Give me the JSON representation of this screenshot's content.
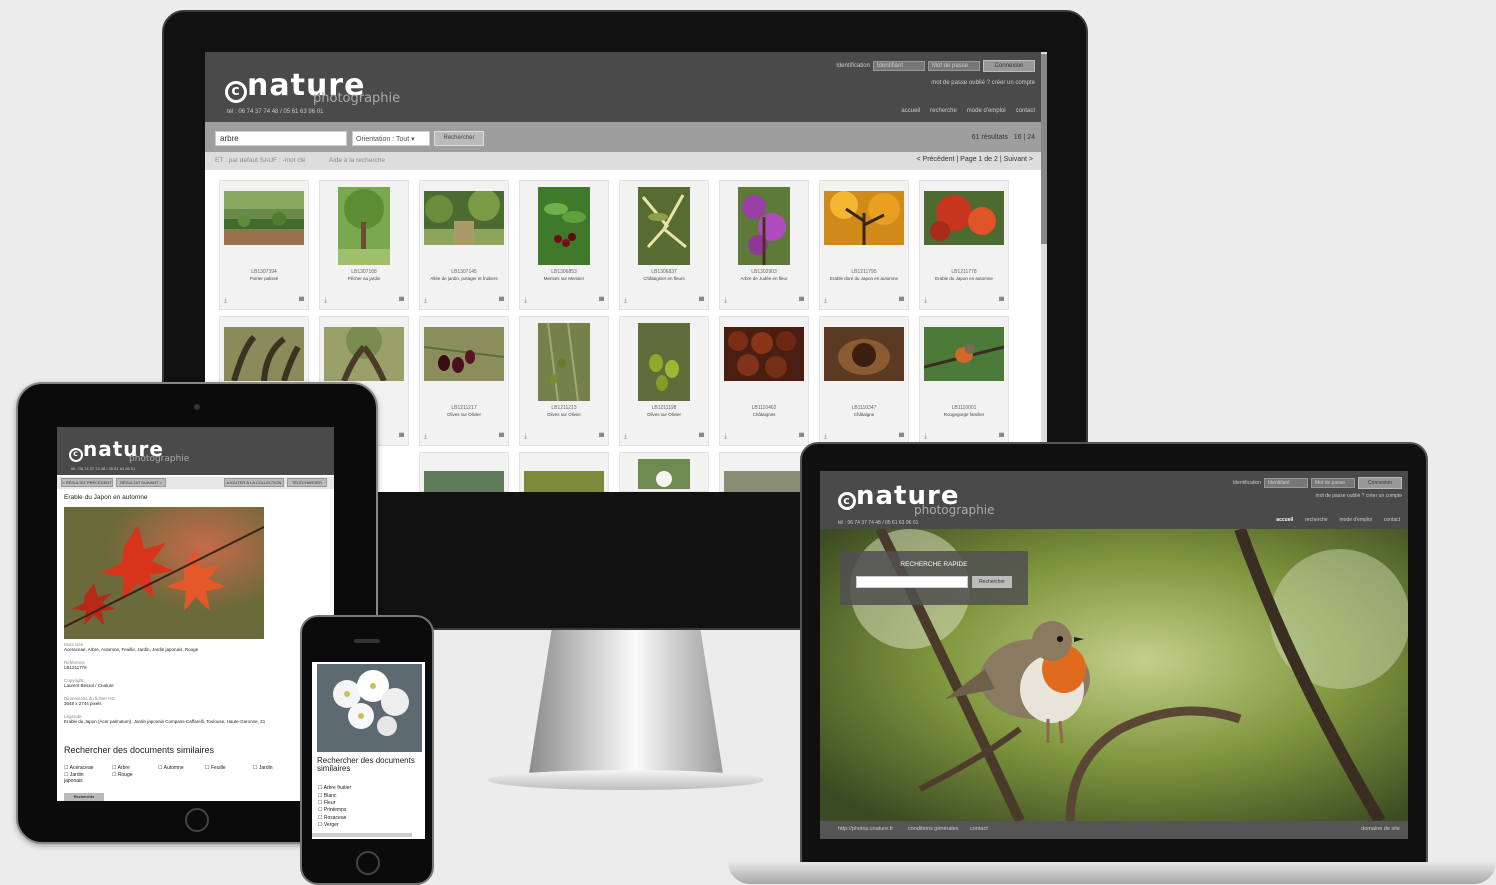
{
  "brand": {
    "logo_letter": "c",
    "logo_word": "nature",
    "logo_sub": "photographie",
    "phone": "tél : 06 74 37 74 48 / 05 61 63 96 01"
  },
  "auth": {
    "identification_label": "Identification",
    "identifier_placeholder": "Identifiant",
    "password_placeholder": "Mot de passe",
    "connect_label": "Connexion",
    "forgot_link": "mot de passe oublié ?",
    "create_account_link": "créer un compte"
  },
  "nav": [
    "accueil",
    "recherche",
    "mode d'emploi",
    "contact"
  ],
  "desktop": {
    "search_value": "arbre",
    "orientation_label": "Orientation : Tout",
    "search_button": "Rechercher",
    "results": "61 résultats",
    "per_page": "16 | 24",
    "hint": "ET : par défaut SAUF : -mot clé",
    "help_link": "Aide à la recherche",
    "pagination": "< Précédent | Page 1 de 2 | Suivant >",
    "row1": [
      {
        "code": "LB1307394",
        "caption": "Poirier palissé"
      },
      {
        "code": "LB1307168",
        "caption": "Pêcher au jardin"
      },
      {
        "code": "LB1307145",
        "caption": "Allée de jardin, potager et fruitiers"
      },
      {
        "code": "LB1306853",
        "caption": "Merises sur Merisier"
      },
      {
        "code": "LB1306837",
        "caption": "Châtaignier en fleurs"
      },
      {
        "code": "LB1302903",
        "caption": "Arbre de Judée en fleur"
      },
      {
        "code": "LB1211795",
        "caption": "Erable doré du Japon en automne"
      },
      {
        "code": "LB1211778",
        "caption": "Erable du Japon en automne"
      }
    ],
    "row2": [
      {
        "code": "",
        "caption": ""
      },
      {
        "code": "",
        "caption": ""
      },
      {
        "code": "LB1211217",
        "caption": "Olives sur Olivier"
      },
      {
        "code": "LB1211213",
        "caption": "Olives sur Olivier"
      },
      {
        "code": "LB1211198",
        "caption": "Olives sur Olivier"
      },
      {
        "code": "LB1110462",
        "caption": "Châtaignes"
      },
      {
        "code": "LB1110347",
        "caption": "Châtaigne"
      },
      {
        "code": "LB1110001",
        "caption": "Rougegorge familier"
      }
    ]
  },
  "tablet": {
    "prev_btn": "< RÉSULTAT PRÉCÉDENT",
    "next_btn": "RÉSULTAT SUIVANT >",
    "add_btn": "AJOUTER À LA COLLECTION",
    "download_btn": "TÉLÉCHARGER",
    "title": "Erable du Japon en automne",
    "meta": [
      {
        "label": "Mots clés",
        "value": "Aceraceae, Arbre, Automne, Feuille, Jardin, Jardin japonais, Rouge"
      },
      {
        "label": "Référence",
        "value": "LB1211778"
      },
      {
        "label": "Copyright",
        "value": "Laurent Bessol / Cnature"
      },
      {
        "label": "Dimensions du fichier HD",
        "value": "3648 x 2744 pixels"
      },
      {
        "label": "Légende",
        "value": "Erable du Japon (Acer palmatum), Jardin japonais Compans-Caffarelli, Toulouse, Haute-Garonne, 31"
      }
    ],
    "similar_title": "Rechercher des documents similaires",
    "checks": [
      "Aceraceae",
      "Arbre",
      "Automne",
      "Feuille",
      "Jardin",
      "Jardin japonais",
      "Rouge"
    ],
    "search_btn": "Rechercher"
  },
  "phone": {
    "similar_title": "Rechercher des documents similaires",
    "checks": [
      "Arbre fruitier",
      "Blanc",
      "Fleur",
      "Printemps",
      "Rosaceae",
      "Verger"
    ]
  },
  "laptop": {
    "quick_title": "RECHERCHE RAPIDE",
    "quick_btn": "Rechercher",
    "footer_url": "http://photos.cnature.fr",
    "footer_cgu": "conditions générales",
    "footer_contact": "contact",
    "footer_right": "domaine de site"
  },
  "colors": {
    "header": "#4a4a4a",
    "searchbar": "#9e9e9e",
    "accent_red": "#c0392b"
  }
}
